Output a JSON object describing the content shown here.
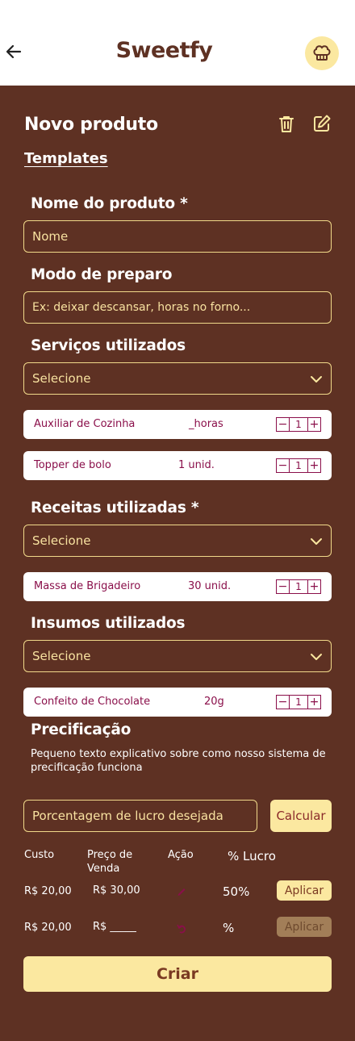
{
  "header": {
    "app_title": "Sweetfy"
  },
  "page": {
    "title": "Novo produto",
    "templates_label": "Templates"
  },
  "product_name": {
    "label": "Nome do produto *",
    "placeholder": "Nome"
  },
  "preparation": {
    "label": "Modo de preparo",
    "placeholder": "Ex: deixar descansar, horas no forno..."
  },
  "services": {
    "label": "Serviços utilizados",
    "select_value": "Selecione",
    "items": [
      {
        "name": "Auxiliar de Cozinha",
        "qty": "_horas",
        "count": "1"
      },
      {
        "name": "Topper de bolo",
        "qty": "1 unid.",
        "count": "1"
      }
    ]
  },
  "recipes": {
    "label": "Receitas utilizadas *",
    "select_value": "Selecione",
    "items": [
      {
        "name": "Massa de Brigadeiro",
        "qty": "30 unid.",
        "count": "1"
      }
    ]
  },
  "supplies": {
    "label": "Insumos utilizados",
    "select_value": "Selecione",
    "items": [
      {
        "name": "Confeito de Chocolate",
        "qty": "20g",
        "count": "1"
      }
    ]
  },
  "pricing": {
    "label": "Precificação",
    "description": "Pequeno texto explicativo sobre como nosso sistema de precificação funciona",
    "profit_placeholder": "Porcentagem de lucro desejada",
    "calc_label": "Calcular",
    "headers": {
      "cost": "Custo",
      "sale_price": "Preço de Venda",
      "action": "Ação",
      "profit": "% Lucro"
    },
    "rows": [
      {
        "cost": "R$ 20,00",
        "price": "R$ 30,00",
        "action_icon": "pencil-icon",
        "profit": "50%",
        "apply_label": "Aplicar",
        "apply_enabled": true
      },
      {
        "cost": "R$ 20,00",
        "price": "R$ _____",
        "action_icon": "undo-icon",
        "profit": "%",
        "apply_label": "Aplicar",
        "apply_enabled": false
      }
    ]
  },
  "create_label": "Criar",
  "colors": {
    "background": "#5e3123",
    "accent": "#fbe8a0",
    "item_text": "#8a0f4a",
    "header_bg": "#ffffff"
  }
}
